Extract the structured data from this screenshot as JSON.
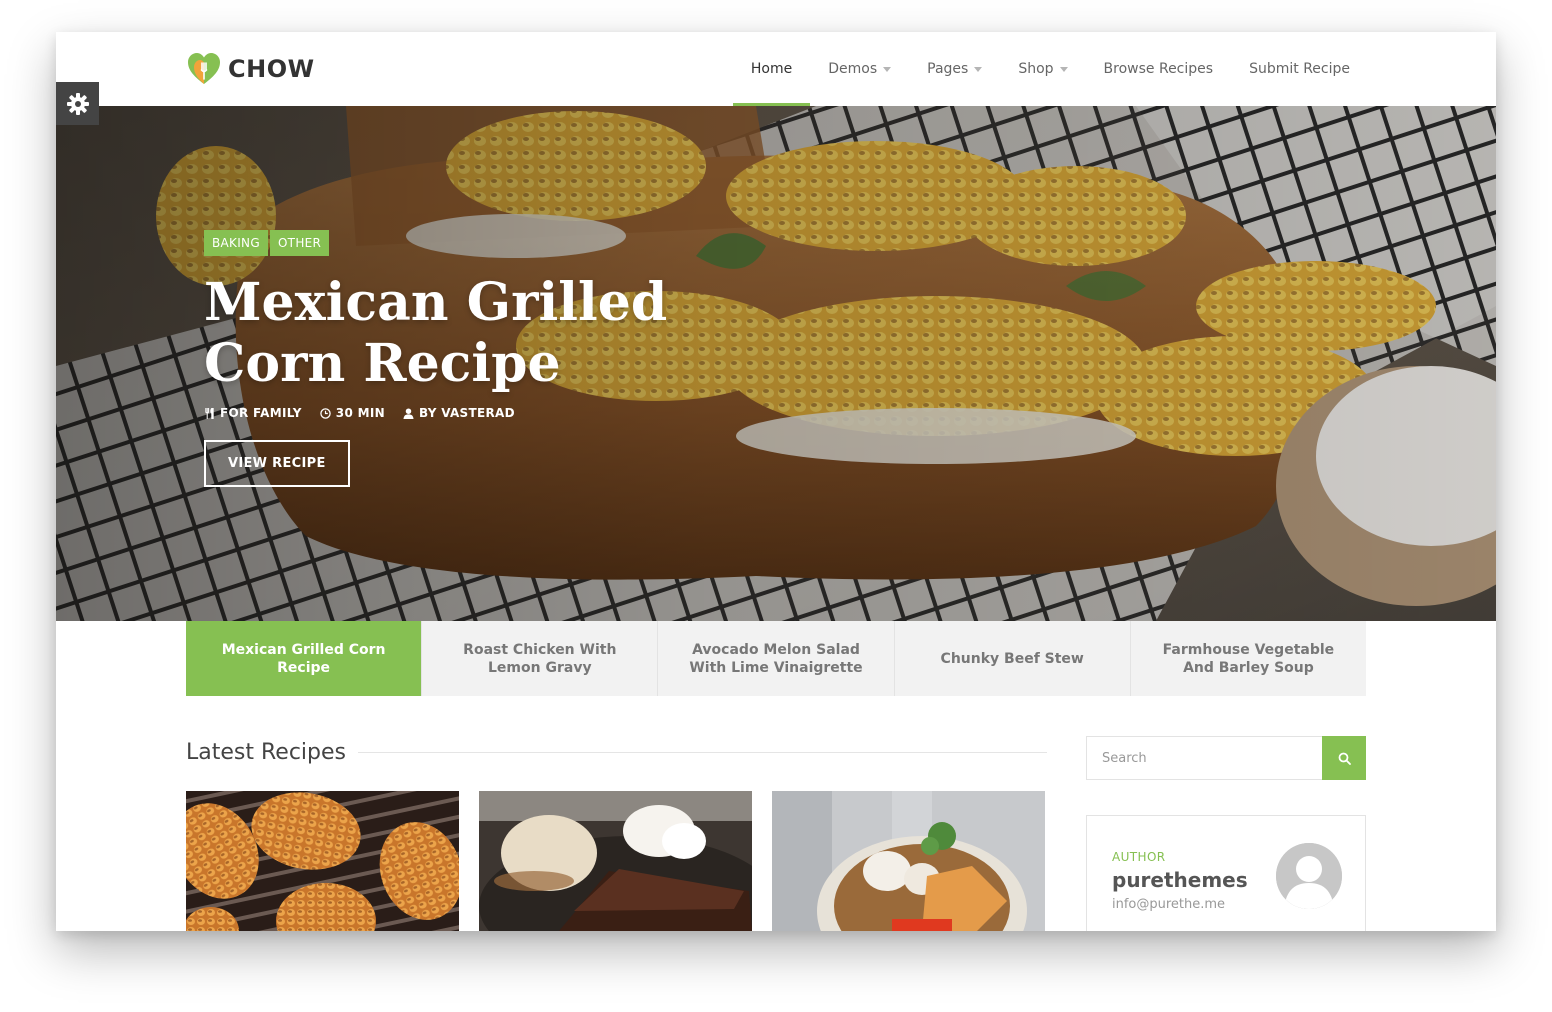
{
  "header": {
    "logo_text": "CHOW",
    "nav": [
      {
        "label": "Home",
        "active": true,
        "dropdown": false
      },
      {
        "label": "Demos",
        "active": false,
        "dropdown": true
      },
      {
        "label": "Pages",
        "active": false,
        "dropdown": true
      },
      {
        "label": "Shop",
        "active": false,
        "dropdown": true
      },
      {
        "label": "Browse Recipes",
        "active": false,
        "dropdown": false
      },
      {
        "label": "Submit Recipe",
        "active": false,
        "dropdown": false
      }
    ]
  },
  "settings": {
    "icon": "gear-icon"
  },
  "hero": {
    "tags": [
      "BAKING",
      "OTHER"
    ],
    "title": "Mexican Grilled Corn Recipe",
    "meta": [
      {
        "icon": "utensils-icon",
        "text": "FOR FAMILY"
      },
      {
        "icon": "clock-icon",
        "text": "30 MIN"
      },
      {
        "icon": "user-icon",
        "text": "BY VASTERAD"
      }
    ],
    "button_label": "VIEW RECIPE"
  },
  "slider_tabs": [
    {
      "label": "Mexican Grilled Corn Recipe",
      "active": true
    },
    {
      "label": "Roast Chicken With Lemon Gravy",
      "active": false
    },
    {
      "label": "Avocado Melon Salad With Lime Vinaigrette",
      "active": false
    },
    {
      "label": "Chunky Beef Stew",
      "active": false
    },
    {
      "label": "Farmhouse Vegetable And Barley Soup",
      "active": false
    }
  ],
  "latest": {
    "title": "Latest Recipes"
  },
  "sidebar": {
    "search_placeholder": "Search",
    "author": {
      "label": "AUTHOR",
      "name": "purethemes",
      "email": "info@purethe.me"
    }
  },
  "colors": {
    "accent": "#86c052",
    "text_dark": "#333333",
    "text_muted": "#777777"
  }
}
